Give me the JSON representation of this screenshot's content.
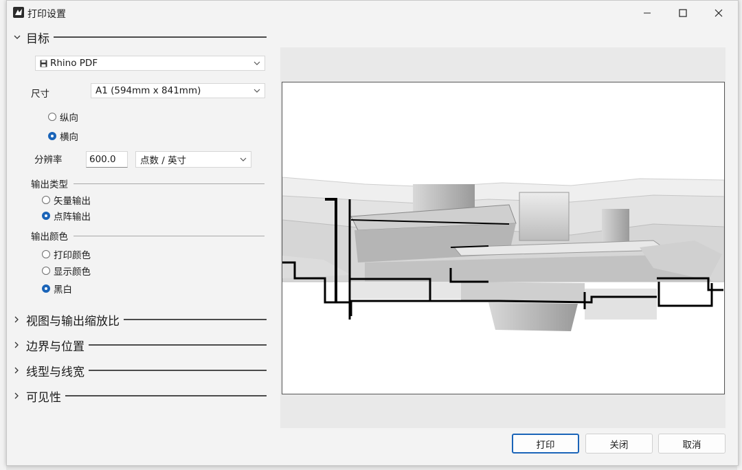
{
  "window": {
    "title": "打印设置"
  },
  "sections": {
    "target": "目标",
    "view_scale": "视图与输出缩放比",
    "margins": "边界与位置",
    "linetype": "线型与线宽",
    "visibility": "可见性"
  },
  "target": {
    "printer": "Rhino PDF",
    "size_label": "尺寸",
    "size_value": "A1 (594mm x 841mm)",
    "orientation": [
      {
        "label": "纵向",
        "selected": false
      },
      {
        "label": "横向",
        "selected": true
      }
    ],
    "resolution_label": "分辨率",
    "resolution_value": "600.0",
    "resolution_unit": "点数 / 英寸",
    "output_type_label": "输出类型",
    "output_type": [
      {
        "label": "矢量输出",
        "selected": false
      },
      {
        "label": "点阵输出",
        "selected": true
      }
    ],
    "output_color_label": "输出颜色",
    "output_color": [
      {
        "label": "打印颜色",
        "selected": false
      },
      {
        "label": "显示颜色",
        "selected": false
      },
      {
        "label": "黑白",
        "selected": true
      }
    ]
  },
  "buttons": {
    "print": "打印",
    "close": "关闭",
    "cancel": "取消"
  }
}
